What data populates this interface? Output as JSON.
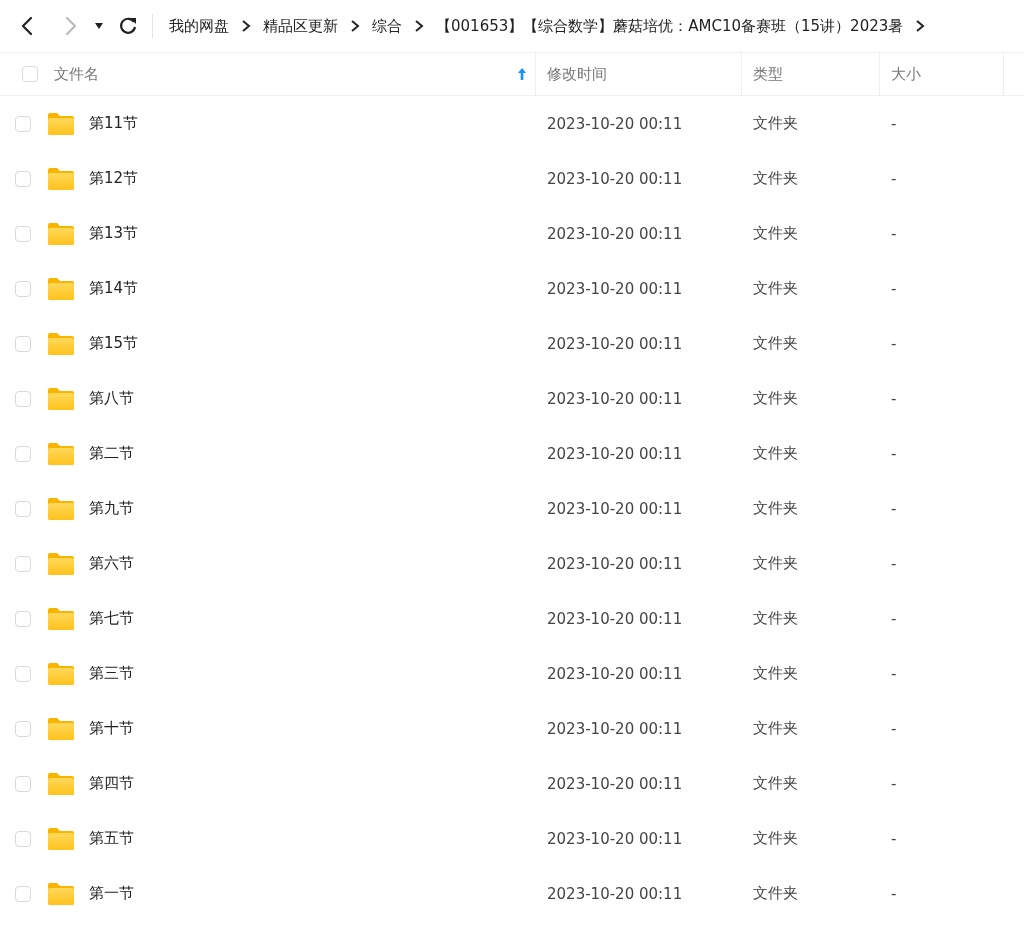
{
  "toolbar": {
    "back_disabled": false,
    "forward_disabled": true,
    "breadcrumbs": [
      "我的网盘",
      "精品区更新",
      "综合",
      "【001653】【综合数学】蘑菇培优：AMC10备赛班（15讲）2023暑"
    ]
  },
  "table": {
    "select_all_checked": false,
    "columns": [
      {
        "label": "文件名",
        "sorted": true
      },
      {
        "label": "修改时间",
        "sorted": false
      },
      {
        "label": "类型",
        "sorted": false
      },
      {
        "label": "大小",
        "sorted": false
      }
    ],
    "rows": [
      {
        "name": "第11节",
        "modified": "2023-10-20 00:11",
        "type": "文件夹",
        "size": "-",
        "checked": false
      },
      {
        "name": "第12节",
        "modified": "2023-10-20 00:11",
        "type": "文件夹",
        "size": "-",
        "checked": false
      },
      {
        "name": "第13节",
        "modified": "2023-10-20 00:11",
        "type": "文件夹",
        "size": "-",
        "checked": false
      },
      {
        "name": "第14节",
        "modified": "2023-10-20 00:11",
        "type": "文件夹",
        "size": "-",
        "checked": false
      },
      {
        "name": "第15节",
        "modified": "2023-10-20 00:11",
        "type": "文件夹",
        "size": "-",
        "checked": false
      },
      {
        "name": "第八节",
        "modified": "2023-10-20 00:11",
        "type": "文件夹",
        "size": "-",
        "checked": false
      },
      {
        "name": "第二节",
        "modified": "2023-10-20 00:11",
        "type": "文件夹",
        "size": "-",
        "checked": false
      },
      {
        "name": "第九节",
        "modified": "2023-10-20 00:11",
        "type": "文件夹",
        "size": "-",
        "checked": false
      },
      {
        "name": "第六节",
        "modified": "2023-10-20 00:11",
        "type": "文件夹",
        "size": "-",
        "checked": false
      },
      {
        "name": "第七节",
        "modified": "2023-10-20 00:11",
        "type": "文件夹",
        "size": "-",
        "checked": false
      },
      {
        "name": "第三节",
        "modified": "2023-10-20 00:11",
        "type": "文件夹",
        "size": "-",
        "checked": false
      },
      {
        "name": "第十节",
        "modified": "2023-10-20 00:11",
        "type": "文件夹",
        "size": "-",
        "checked": false
      },
      {
        "name": "第四节",
        "modified": "2023-10-20 00:11",
        "type": "文件夹",
        "size": "-",
        "checked": false
      },
      {
        "name": "第五节",
        "modified": "2023-10-20 00:11",
        "type": "文件夹",
        "size": "-",
        "checked": false
      },
      {
        "name": "第一节",
        "modified": "2023-10-20 00:11",
        "type": "文件夹",
        "size": "-",
        "checked": false
      }
    ]
  }
}
